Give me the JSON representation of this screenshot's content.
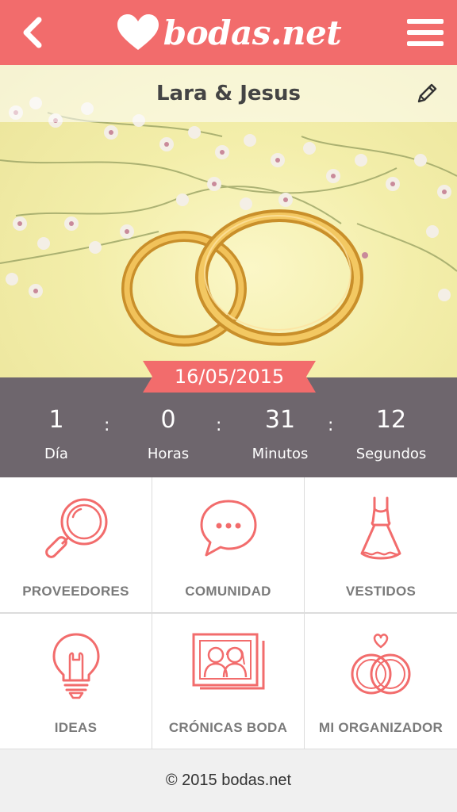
{
  "header": {
    "brand": "bodas.net",
    "back_icon": "chevron-left-icon",
    "menu_icon": "hamburger-menu-icon",
    "color": "#f26c6c"
  },
  "wedding": {
    "couple": "Lara & Jesus",
    "date": "16/05/2015",
    "edit_icon": "pencil-icon"
  },
  "countdown": {
    "days": {
      "value": "1",
      "label": "Día"
    },
    "hours": {
      "value": "0",
      "label": "Horas"
    },
    "minutes": {
      "value": "31",
      "label": "Minutos"
    },
    "seconds": {
      "value": "12",
      "label": "Segundos"
    },
    "separator": ":"
  },
  "menu": [
    {
      "label": "PROVEEDORES",
      "icon": "magnifier-icon"
    },
    {
      "label": "COMUNIDAD",
      "icon": "chat-bubble-icon"
    },
    {
      "label": "VESTIDOS",
      "icon": "dress-icon"
    },
    {
      "label": "IDEAS",
      "icon": "lightbulb-icon"
    },
    {
      "label": "CRÓNICAS BODA",
      "icon": "photo-couple-icon"
    },
    {
      "label": "MI ORGANIZADOR",
      "icon": "rings-heart-icon"
    }
  ],
  "footer": {
    "copyright": "© 2015 bodas.net"
  }
}
